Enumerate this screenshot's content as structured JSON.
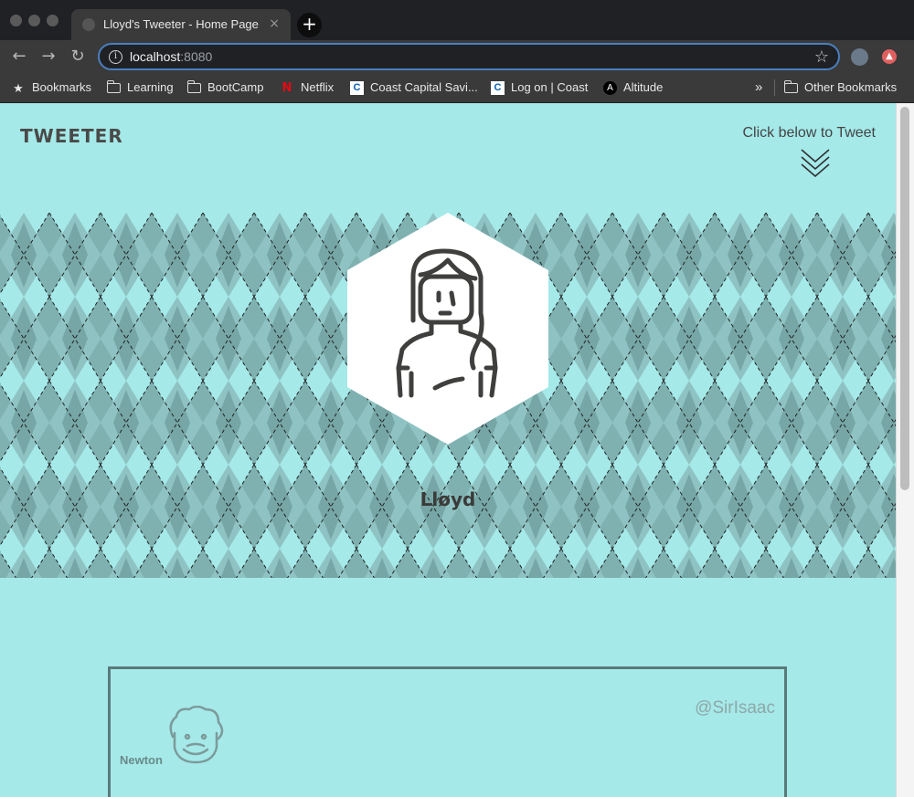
{
  "browser": {
    "tab_title": "Lloyd's Tweeter - Home Page",
    "tab_close": "×",
    "new_tab": "+",
    "url_host": "localhost",
    "url_port": ":8080",
    "back_icon": "←",
    "forward_icon": "→",
    "reload_icon": "↻",
    "star_icon": "☆"
  },
  "bookmarks": {
    "items": [
      {
        "label": "Bookmarks",
        "icon": "star-icon"
      },
      {
        "label": "Learning",
        "icon": "folder-icon"
      },
      {
        "label": "BootCamp",
        "icon": "folder-icon"
      },
      {
        "label": "Netflix",
        "icon": "netflix-icon"
      },
      {
        "label": "Coast Capital Savi...",
        "icon": "coast-capital-icon"
      },
      {
        "label": "Log on | Coast",
        "icon": "coast-capital-icon"
      },
      {
        "label": "Altitude",
        "icon": "altitude-icon"
      }
    ],
    "overflow": "»",
    "other": "Other Bookmarks"
  },
  "page": {
    "brand": "TWEETER",
    "compose_hint": "Click below to Tweet",
    "profile_name": "Lløyd",
    "colors": {
      "background": "#a5e9e9",
      "argyle_dark": "#7fb1b1",
      "argyle_mid": "#8fc3c3",
      "text": "#4a4a48"
    }
  },
  "tweets": [
    {
      "name": "Newton",
      "handle": "@SirIsaac"
    }
  ]
}
